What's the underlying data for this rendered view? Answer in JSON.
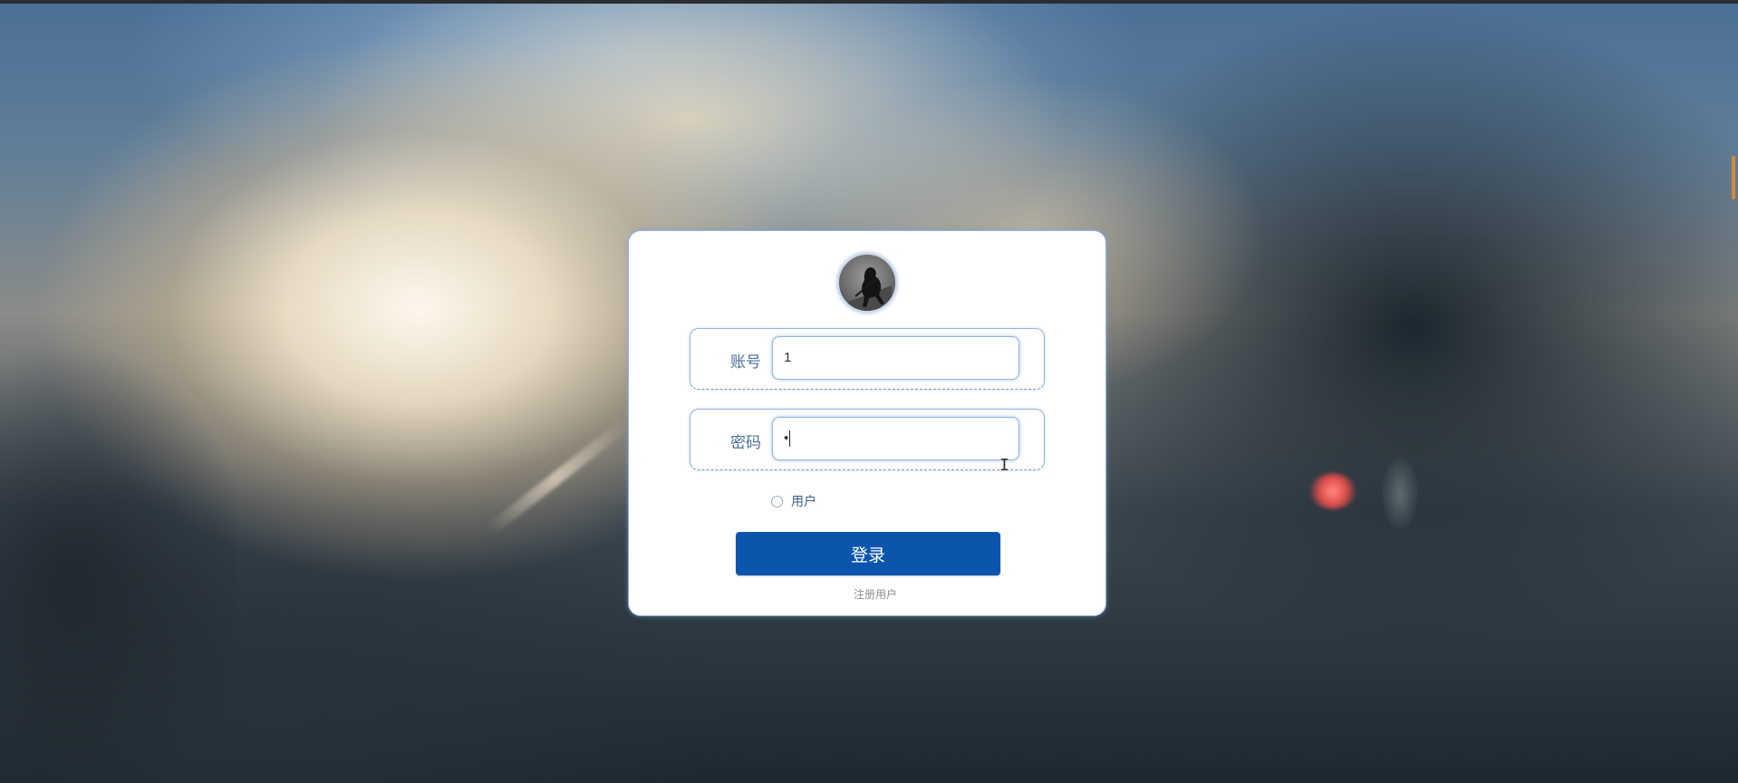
{
  "login_form": {
    "account": {
      "label": "账号",
      "value": "1"
    },
    "password": {
      "label": "密码",
      "value": "•"
    },
    "role_option": {
      "label": "用户",
      "checked": false
    },
    "login_button": "登录",
    "register_link": "注册用户"
  },
  "icons": {
    "avatar": "avatar-photo",
    "radio": "radio-button",
    "cursor": "text-cursor-icon"
  },
  "colors": {
    "primary_button": "#0b56ac",
    "label_text": "#4a6f9a",
    "card_border": "#8fb3de"
  }
}
